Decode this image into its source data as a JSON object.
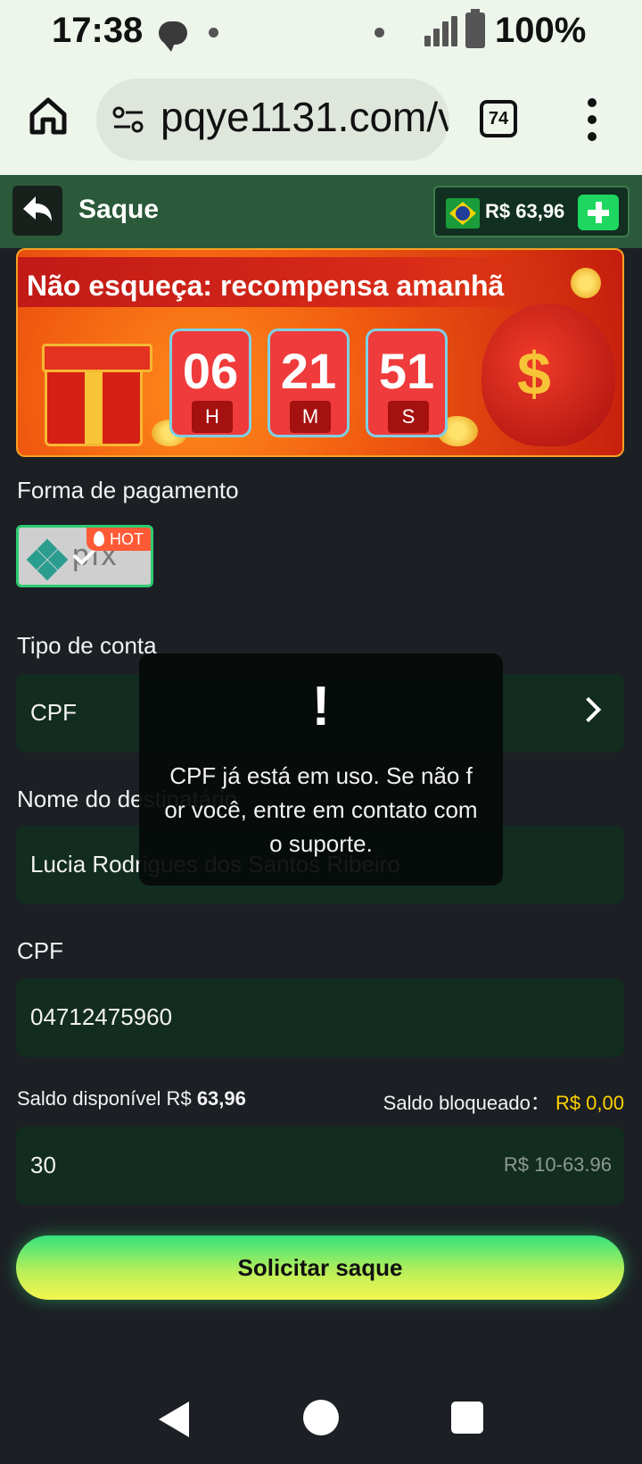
{
  "status_bar": {
    "time": "17:38",
    "battery": "100%"
  },
  "browser": {
    "url": "pqye1131.com/v",
    "tab_count": "74"
  },
  "header": {
    "title": "Saque",
    "balance": "R$ 63,96"
  },
  "banner": {
    "text": "Não esqueça: recompensa amanhã",
    "countdown": [
      {
        "value": "06",
        "unit": "H"
      },
      {
        "value": "21",
        "unit": "M"
      },
      {
        "value": "51",
        "unit": "S"
      }
    ]
  },
  "payment": {
    "label": "Forma de pagamento",
    "method": "pix",
    "badge": "HOT"
  },
  "account_type": {
    "label": "Tipo de conta",
    "value": "CPF"
  },
  "recipient": {
    "label": "Nome do destinatário",
    "value": "Lucia Rodrigues dos Santos Ribeiro"
  },
  "cpf": {
    "label": "CPF",
    "value": "04712475960"
  },
  "saldo": {
    "available_label": "Saldo disponível R$",
    "available_value": "63,96",
    "blocked_label": "Saldo bloqueado：",
    "blocked_value": "R$ 0,00"
  },
  "amount": {
    "value": "30",
    "range": "R$ 10-63.96"
  },
  "submit_label": "Solicitar saque",
  "toast": {
    "icon": "!",
    "message": "CPF já está em uso. Se não for você, entre em contato com o suporte."
  },
  "colors": {
    "accent_green": "#1ed760",
    "header_bg": "#2b5a3b",
    "field_bg": "#132c20",
    "blocked_yellow": "#ffd200"
  },
  "icons": [
    "home-icon",
    "tune-icon",
    "more-vert-icon",
    "back-arrow-icon",
    "plus-icon",
    "brazil-flag-icon",
    "pix-logo-icon",
    "flame-icon",
    "chevron-right-icon",
    "nav-back-icon",
    "nav-home-icon",
    "nav-recents-icon"
  ]
}
